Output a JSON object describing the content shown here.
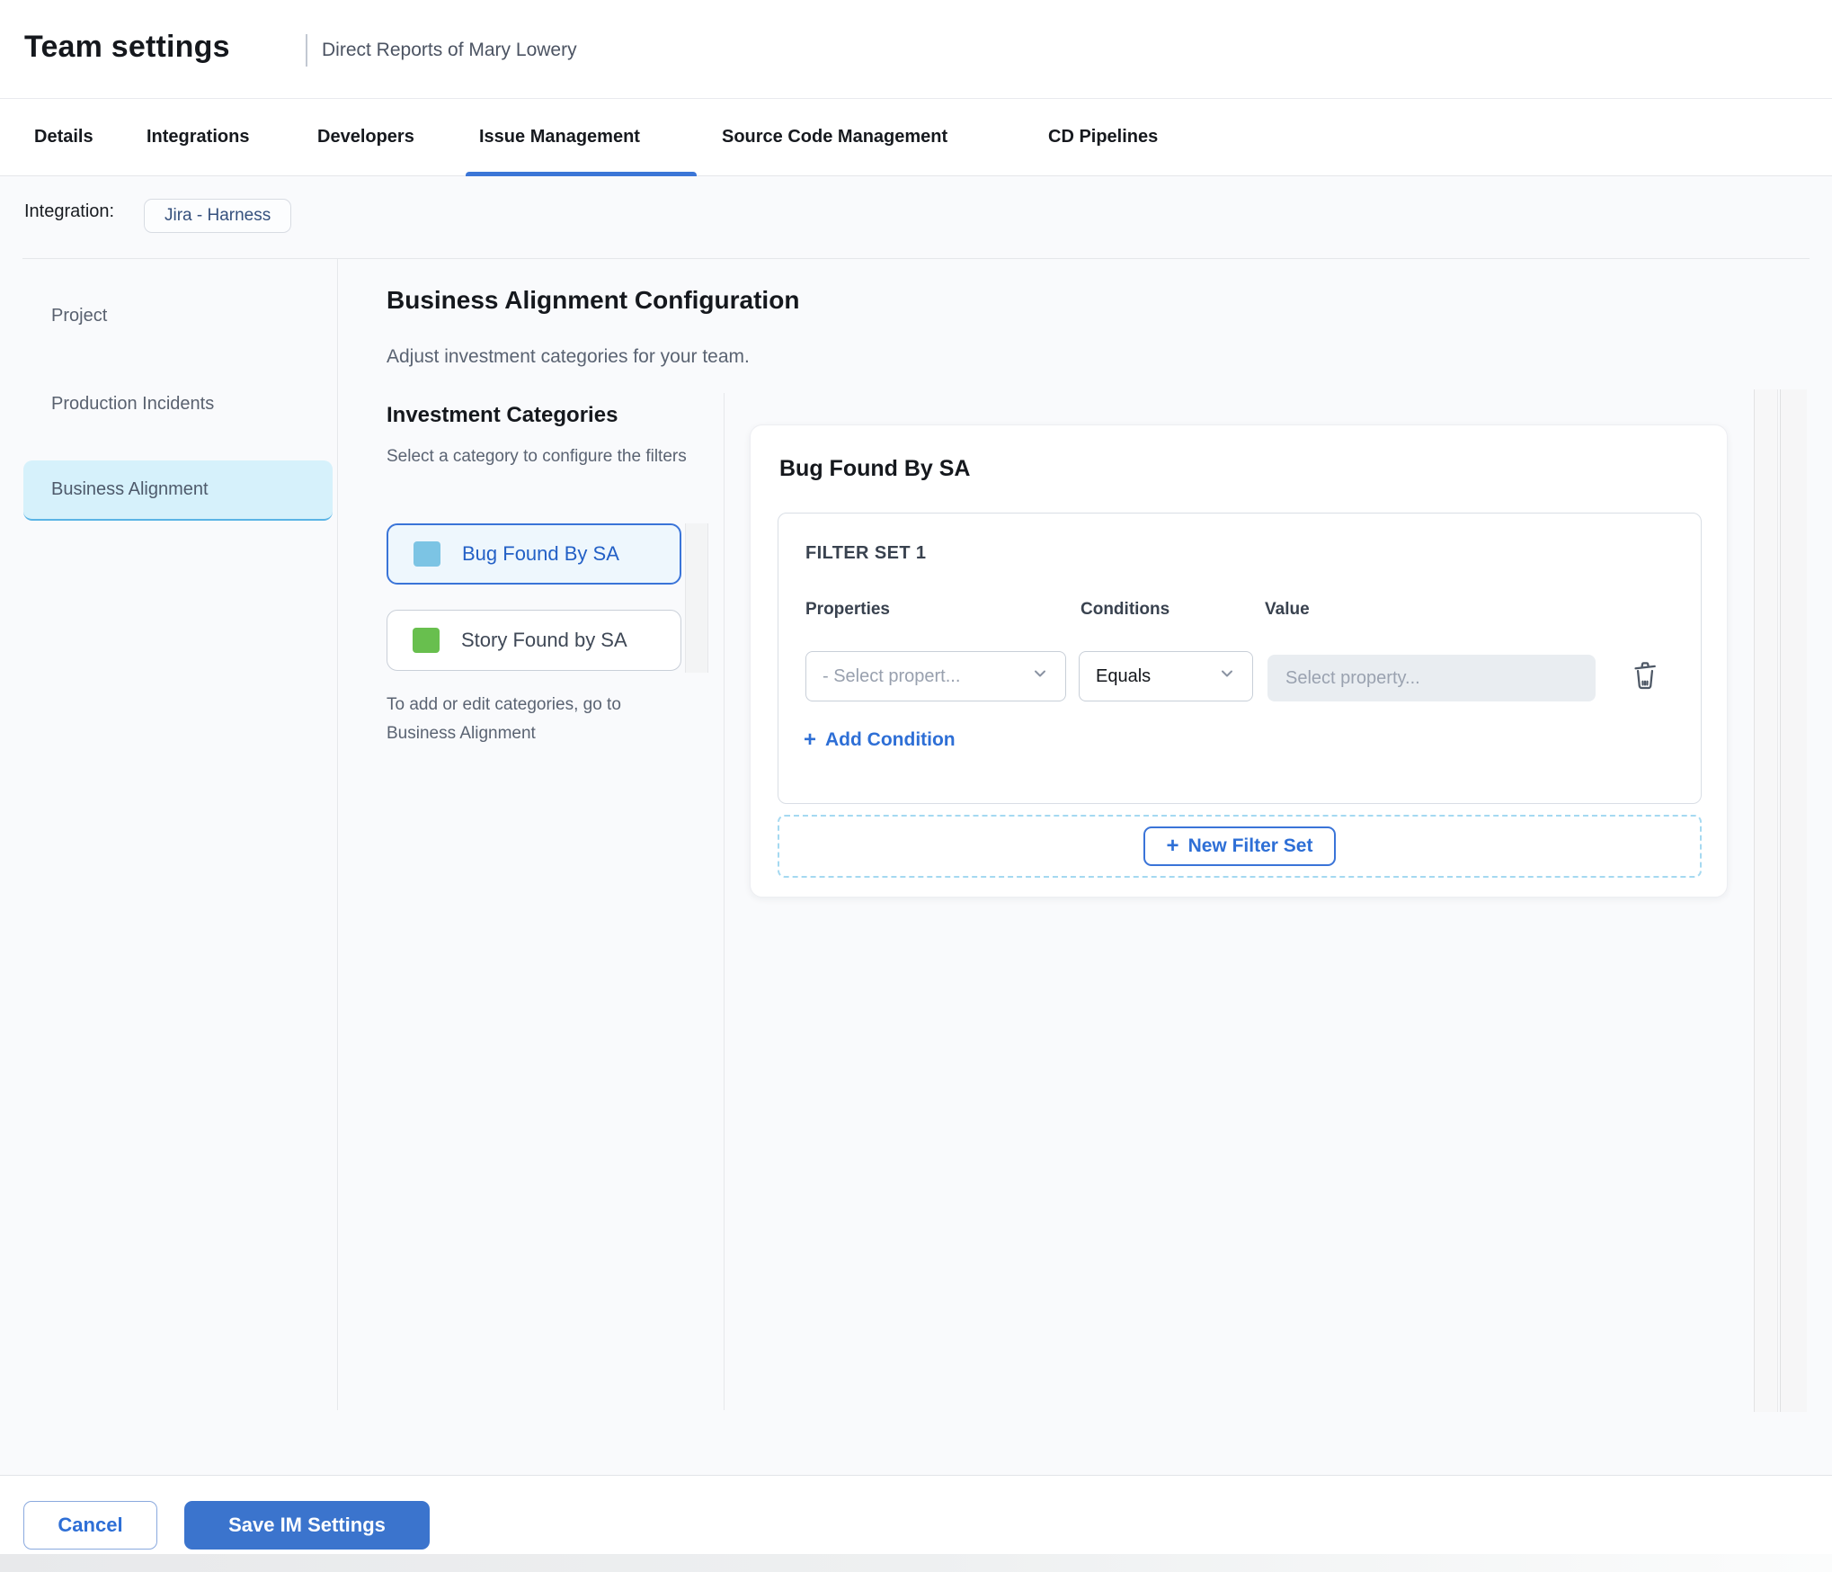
{
  "header": {
    "title": "Team settings",
    "subtitle": "Direct Reports of Mary Lowery"
  },
  "tabs": {
    "items": [
      {
        "label": "Details"
      },
      {
        "label": "Integrations"
      },
      {
        "label": "Developers"
      },
      {
        "label": "Issue Management"
      },
      {
        "label": "Source Code Management"
      },
      {
        "label": "CD Pipelines"
      }
    ],
    "active": "Issue Management"
  },
  "integration": {
    "label": "Integration:",
    "chip": "Jira - Harness"
  },
  "sidebar": {
    "items": [
      {
        "label": "Project"
      },
      {
        "label": "Production Incidents"
      },
      {
        "label": "Business Alignment"
      }
    ],
    "active": "Business Alignment"
  },
  "main": {
    "title": "Business Alignment Configuration",
    "subtitle": "Adjust investment categories for your team.",
    "categories": {
      "heading": "Investment Categories",
      "description": "Select a category to configure the filters",
      "items": [
        {
          "label": "Bug Found By SA",
          "swatch_color": "#7cc4e4",
          "selected": true
        },
        {
          "label": "Story Found by SA",
          "swatch_color": "#68bf4e",
          "selected": false
        }
      ],
      "footnote": "To add or edit categories, go to Business Alignment"
    },
    "filter_panel": {
      "title": "Bug Found By SA",
      "filter_set_label": "FILTER SET 1",
      "columns": {
        "properties": "Properties",
        "conditions": "Conditions",
        "value": "Value"
      },
      "property_placeholder": "- Select propert...",
      "condition_value": "Equals",
      "value_placeholder": "Select property...",
      "add_condition_plus": "+",
      "add_condition_label": "Add Condition",
      "new_filter_set_plus": "+",
      "new_filter_set_label": "New Filter Set"
    }
  },
  "footer": {
    "cancel_label": "Cancel",
    "save_label": "Save IM Settings"
  },
  "colors": {
    "accent_blue": "#3b74cd",
    "link_blue": "#2e6fd6",
    "active_tab_underline": "#3b76d7",
    "sidebar_selected_bg": "#d6f1fb",
    "category_selected_bg": "#eef7fd",
    "category_selected_border": "#3a74d8",
    "swatch_blue": "#7cc4e4",
    "swatch_green": "#68bf4e",
    "dashed_border": "#a5d9f1",
    "content_background": "#f9fafc"
  }
}
